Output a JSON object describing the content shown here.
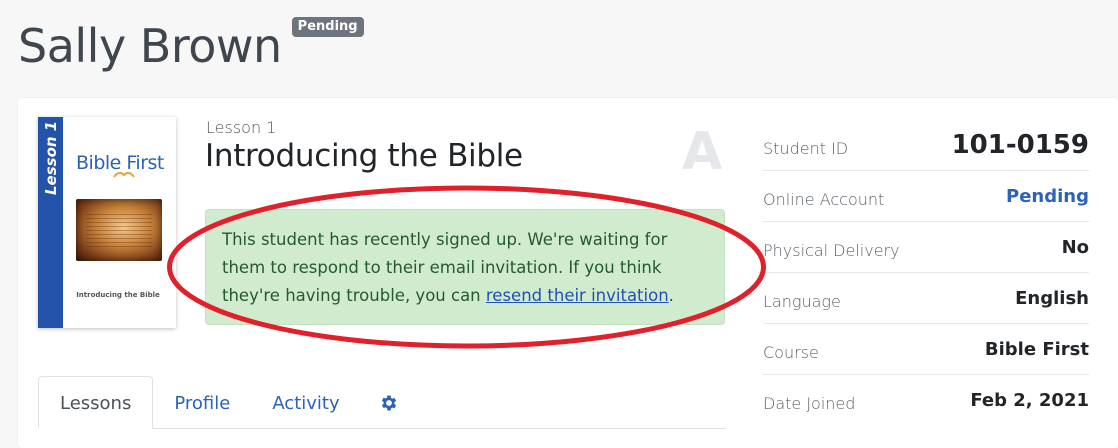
{
  "header": {
    "name": "Sally Brown",
    "status_badge": "Pending"
  },
  "book": {
    "spine_text": "Lesson 1",
    "brand": "Bible First",
    "subtitle": "Introducing the Bible"
  },
  "lesson": {
    "label": "Lesson 1",
    "title": "Introducing the Bible",
    "grade": "A"
  },
  "alert": {
    "text": "This student has recently signed up. We're waiting for them to respond to their email invitation. If you think they're having trouble, you can ",
    "link_text": "resend their invitation",
    "suffix": "."
  },
  "tabs": [
    {
      "label": "Lessons",
      "active": true
    },
    {
      "label": "Profile",
      "active": false
    },
    {
      "label": "Activity",
      "active": false
    }
  ],
  "settings_icon": "gear-icon",
  "details": [
    {
      "label": "Student ID",
      "value": "101-0159"
    },
    {
      "label": "Online Account",
      "value": "Pending"
    },
    {
      "label": "Physical Delivery",
      "value": "No"
    },
    {
      "label": "Language",
      "value": "English"
    },
    {
      "label": "Course",
      "value": "Bible First"
    },
    {
      "label": "Date Joined",
      "value": "Feb 2, 2021"
    }
  ],
  "colors": {
    "link": "#2c62b8",
    "alert_bg": "#d1ebcf",
    "badge_bg": "#6c757d",
    "annotation": "#e0202a",
    "spine": "#2354a9"
  }
}
